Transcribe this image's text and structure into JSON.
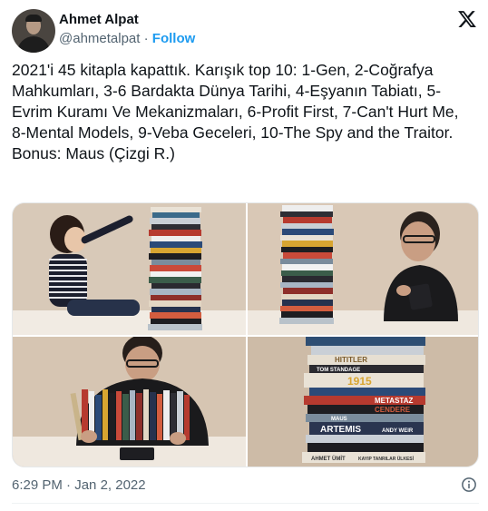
{
  "author": {
    "name": "Ahmet Alpat",
    "handle": "@ahmetalpat",
    "separator": " · ",
    "follow_label": "Follow",
    "avatar_icon": "profile-photo"
  },
  "brand": {
    "logo_icon": "x-logo"
  },
  "tweet": {
    "text": "2021'i 45 kitapla kapattık. Karışık top 10: 1-Gen, 2-Coğrafya Mahkumları, 3-6 Bardakta Dünya Tarihi, 4-Eşyanın Tabiatı, 5-Evrim Kuramı Ve Mekanizmaları, 6-Profit First, 7-Can't Hurt Me, 8-Mental Models, 9-Veba Geceleri, 10-The Spy and the Traitor. Bonus: Maus (Çizgi R.)",
    "photos": [
      {
        "label": "girl-with-book-stack"
      },
      {
        "label": "man-with-book-stack"
      },
      {
        "label": "man-with-books-on-table"
      },
      {
        "label": "book-spines-closeup",
        "spines": [
          "HITITLER",
          "TOM STANDAGE",
          "1915",
          "METASTAZ",
          "CENDERE",
          "MAUS",
          "ARTEMIS",
          "ANDY WEIR",
          "AHMET ÜMİT",
          "KAYIP TANRILAR ÜLKESİ"
        ]
      }
    ],
    "time": "6:29 PM",
    "date_separator": " · ",
    "date": "Jan 2, 2022"
  },
  "colors": {
    "accent": "#1d9bf0",
    "text": "#0f1419",
    "muted": "#536471"
  }
}
